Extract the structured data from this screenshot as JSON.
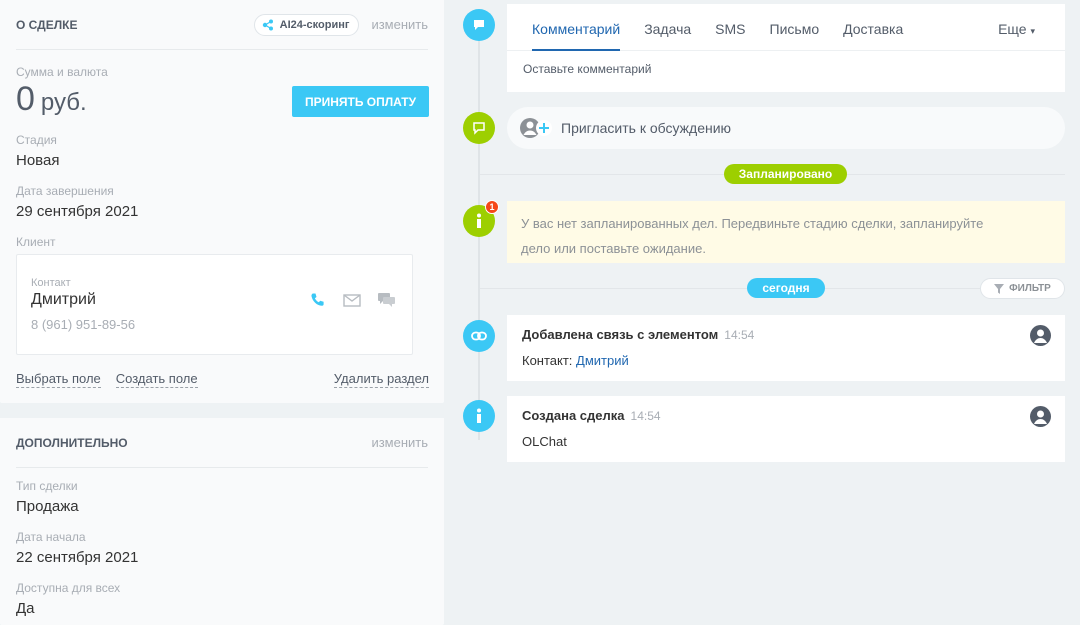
{
  "deal_card": {
    "title": "О СДЕЛКЕ",
    "ai_badge": "AI24-скоринг",
    "change": "изменить",
    "amount_label": "Сумма и валюта",
    "amount": "0",
    "currency": "руб.",
    "pay_button": "ПРИНЯТЬ ОПЛАТУ",
    "stage_label": "Стадия",
    "stage": "Новая",
    "close_date_label": "Дата завершения",
    "close_date": "29 сентября 2021",
    "client_label": "Клиент",
    "contact_label": "Контакт",
    "contact_name": "Дмитрий",
    "contact_phone": "8 (961) 951-89-56",
    "select_field": "Выбрать поле",
    "create_field": "Создать поле",
    "delete_section": "Удалить раздел"
  },
  "extra_card": {
    "title": "ДОПОЛНИТЕЛЬНО",
    "change": "изменить",
    "type_label": "Тип сделки",
    "type": "Продажа",
    "start_label": "Дата начала",
    "start": "22 сентября 2021",
    "available_label": "Доступна для всех",
    "available": "Да"
  },
  "timeline": {
    "tabs": [
      "Комментарий",
      "Задача",
      "SMS",
      "Письмо",
      "Доставка"
    ],
    "more": "Еще",
    "comment_placeholder": "Оставьте комментарий",
    "invite": "Пригласить к обсуждению",
    "planned": "Запланировано",
    "planned_badge": "1",
    "notice_line1": "У вас нет запланированных дел. Передвиньте стадию сделки, запланируйте",
    "notice_line2": "дело или поставьте ожидание.",
    "today": "сегодня",
    "filter": "ФИЛЬТР",
    "events": [
      {
        "title": "Добавлена связь с элементом",
        "time": "14:54",
        "text_prefix": "Контакт: ",
        "link": "Дмитрий"
      },
      {
        "title": "Создана сделка",
        "time": "14:54",
        "text": "OLChat"
      }
    ]
  },
  "colors": {
    "accent_blue": "#3bc8f5",
    "accent_green": "#9dcf00",
    "link": "#2067b0"
  }
}
